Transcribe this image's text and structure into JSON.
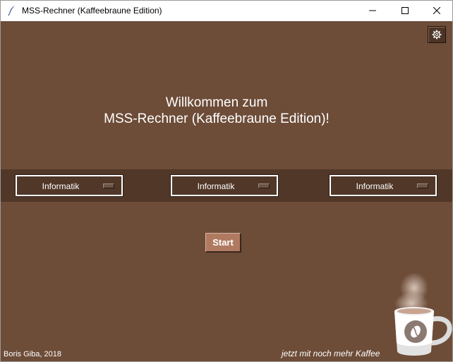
{
  "window": {
    "title": "MSS-Rechner (Kaffeebraune Edition)",
    "controls": [
      "minimize",
      "maximize",
      "close"
    ]
  },
  "settings": {
    "icon": "gear-icon"
  },
  "welcome": {
    "line1": "Willkommen zum",
    "line2": "MSS-Rechner (Kaffeebraune Edition)!"
  },
  "subjects": [
    {
      "selected": "Informatik"
    },
    {
      "selected": "Informatik"
    },
    {
      "selected": "Informatik"
    }
  ],
  "start_button": {
    "label": "Start"
  },
  "footer": {
    "credit": "Boris Giba, 2018",
    "slogan": "jetzt mit noch mehr Kaffee"
  },
  "colors": {
    "background": "#6d4c38",
    "band": "#513728",
    "start_button": "#b07a61",
    "text": "#ffffff"
  }
}
